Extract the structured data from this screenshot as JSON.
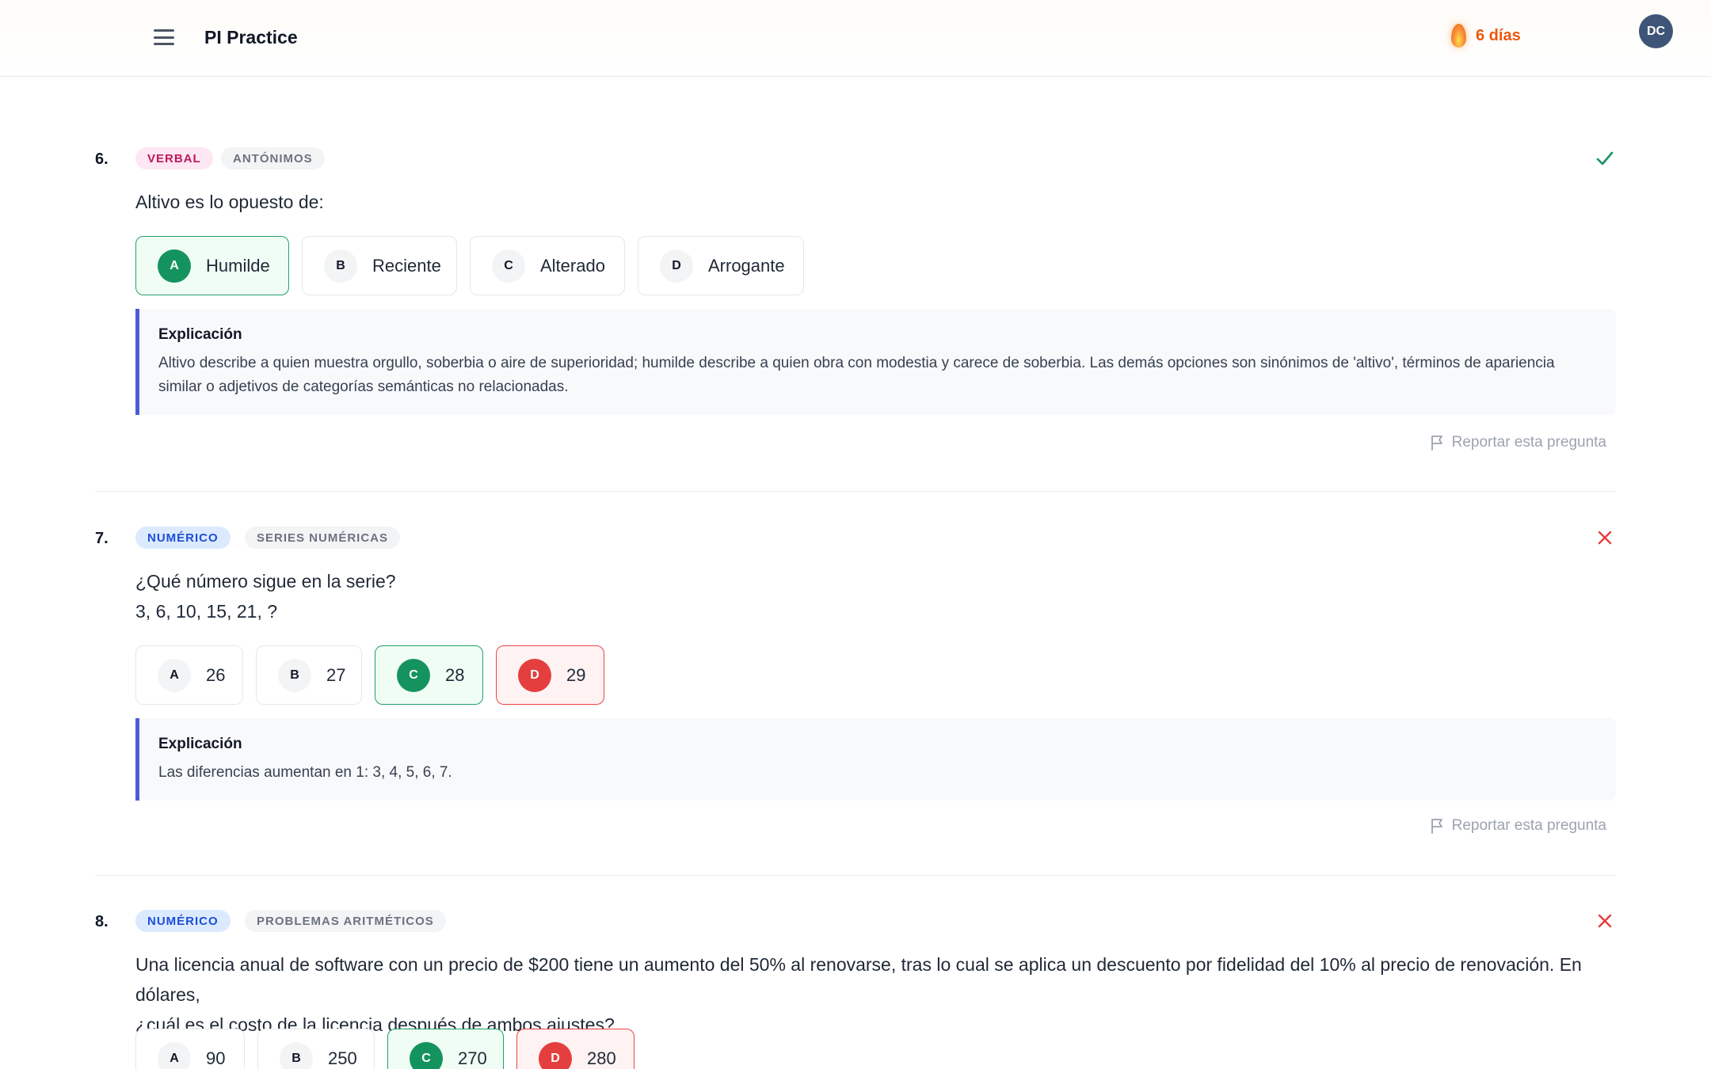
{
  "header": {
    "title": "PI Practice",
    "streak": "6 días",
    "avatar_initials": "DC",
    "menu_icon": "hamburger-icon",
    "streak_icon": "flame-icon"
  },
  "colors": {
    "correct": "#15935f",
    "wrong": "#e53e3e",
    "accent": "#4f5bd5",
    "streak": "#ea580c"
  },
  "questions": [
    {
      "number": "6.",
      "category": "VERBAL",
      "topic": "ANTÓNIMOS",
      "result": "correct",
      "text": [
        "Altivo es lo opuesto de:"
      ],
      "options": [
        {
          "letter": "A",
          "label": "Humilde",
          "state": "correct"
        },
        {
          "letter": "B",
          "label": "Reciente",
          "state": "neutral"
        },
        {
          "letter": "C",
          "label": "Alterado",
          "state": "neutral"
        },
        {
          "letter": "D",
          "label": "Arrogante",
          "state": "neutral"
        }
      ],
      "explanation_title": "Explicación",
      "explanation": "Altivo describe a quien muestra orgullo, soberbia o aire de superioridad; humilde describe a quien obra con modestia y carece de soberbia. Las demás opciones son sinónimos de 'altivo', términos de apariencia similar o adjetivos de categorías semánticas no relacionadas.",
      "report_label": "Reportar esta pregunta"
    },
    {
      "number": "7.",
      "category": "NUMÉRICO",
      "topic": "SERIES NUMÉRICAS",
      "result": "wrong",
      "text": [
        "¿Qué número sigue en la serie?",
        "3, 6, 10, 15, 21, ?"
      ],
      "options": [
        {
          "letter": "A",
          "label": "26",
          "state": "neutral"
        },
        {
          "letter": "B",
          "label": "27",
          "state": "neutral"
        },
        {
          "letter": "C",
          "label": "28",
          "state": "correct"
        },
        {
          "letter": "D",
          "label": "29",
          "state": "wrong"
        }
      ],
      "explanation_title": "Explicación",
      "explanation": "Las diferencias aumentan en 1: 3, 4, 5, 6, 7.",
      "report_label": "Reportar esta pregunta"
    },
    {
      "number": "8.",
      "category": "NUMÉRICO",
      "topic": "PROBLEMAS ARITMÉTICOS",
      "result": "wrong",
      "text": [
        "Una licencia anual de software con un precio de $200 tiene un aumento del 50% al renovarse, tras lo cual se aplica un descuento por fidelidad del 10% al precio de renovación. En dólares,",
        "¿cuál es el costo de la licencia después de ambos ajustes?"
      ],
      "options": [
        {
          "letter": "A",
          "label": "90",
          "state": "neutral"
        },
        {
          "letter": "B",
          "label": "250",
          "state": "neutral"
        },
        {
          "letter": "C",
          "label": "270",
          "state": "correct"
        },
        {
          "letter": "D",
          "label": "280",
          "state": "wrong"
        }
      ]
    }
  ]
}
